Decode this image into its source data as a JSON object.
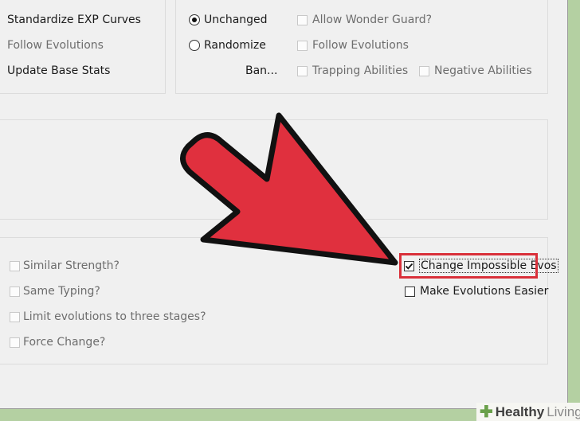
{
  "left_panel": {
    "items": [
      {
        "label": "Standardize EXP Curves",
        "enabled": true
      },
      {
        "label": "Follow Evolutions",
        "enabled": false
      },
      {
        "label": "Update Base Stats",
        "enabled": true
      }
    ]
  },
  "abilities_panel": {
    "radios": [
      {
        "label": "Unchanged",
        "selected": true
      },
      {
        "label": "Randomize",
        "selected": false
      }
    ],
    "ban_label": "Ban...",
    "checkboxes": [
      {
        "label": "Allow Wonder Guard?",
        "checked": false,
        "enabled": false
      },
      {
        "label": "Follow Evolutions",
        "checked": false,
        "enabled": false
      },
      {
        "label": "Trapping Abilities",
        "checked": false,
        "enabled": false
      },
      {
        "label": "Negative Abilities",
        "checked": false,
        "enabled": false
      }
    ]
  },
  "evolutions_panel": {
    "left_checkboxes": [
      {
        "label": "Similar Strength?",
        "checked": false,
        "enabled": false
      },
      {
        "label": "Same Typing?",
        "checked": false,
        "enabled": false
      },
      {
        "label": "Limit evolutions to three stages?",
        "checked": false,
        "enabled": false
      },
      {
        "label": "Force Change?",
        "checked": false,
        "enabled": false
      }
    ],
    "right_checkboxes": [
      {
        "label": "Change Impossible Evos",
        "checked": true,
        "enabled": true
      },
      {
        "label": "Make Evolutions Easier",
        "checked": false,
        "enabled": true
      }
    ]
  },
  "watermark": {
    "word1": "Healthy",
    "word2": "Living"
  },
  "colors": {
    "highlight": "#d9303a",
    "arrow": "#e0303e",
    "background": "#b4d0a2"
  }
}
